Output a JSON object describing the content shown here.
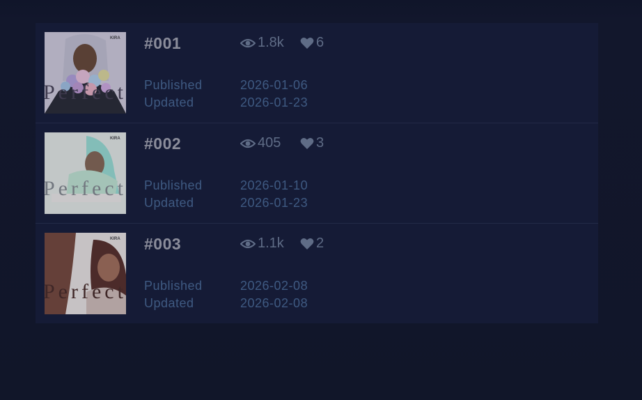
{
  "items": [
    {
      "number": "#001",
      "views": "1.8k",
      "likes": "6",
      "published_label": "Published",
      "published": "2026-01-06",
      "updated_label": "Updated",
      "updated": "2026-01-23",
      "cover_text": "Perfect",
      "cover_author": "KIRA"
    },
    {
      "number": "#002",
      "views": "405",
      "likes": "3",
      "published_label": "Published",
      "published": "2026-01-10",
      "updated_label": "Updated",
      "updated": "2026-01-23",
      "cover_text": "Perfect",
      "cover_author": "KIRA"
    },
    {
      "number": "#003",
      "views": "1.1k",
      "likes": "2",
      "published_label": "Published",
      "published": "2026-02-08",
      "updated_label": "Updated",
      "updated": "2026-02-08",
      "cover_text": "Perfect",
      "cover_author": "KIRA"
    }
  ],
  "icons": {
    "views": "eye-icon",
    "likes": "heart-icon"
  },
  "colors": {
    "background": "#111629",
    "card": "#151b36",
    "number": "#8b8d9b",
    "stat": "#5f6c86",
    "meta": "#3f5a82"
  }
}
